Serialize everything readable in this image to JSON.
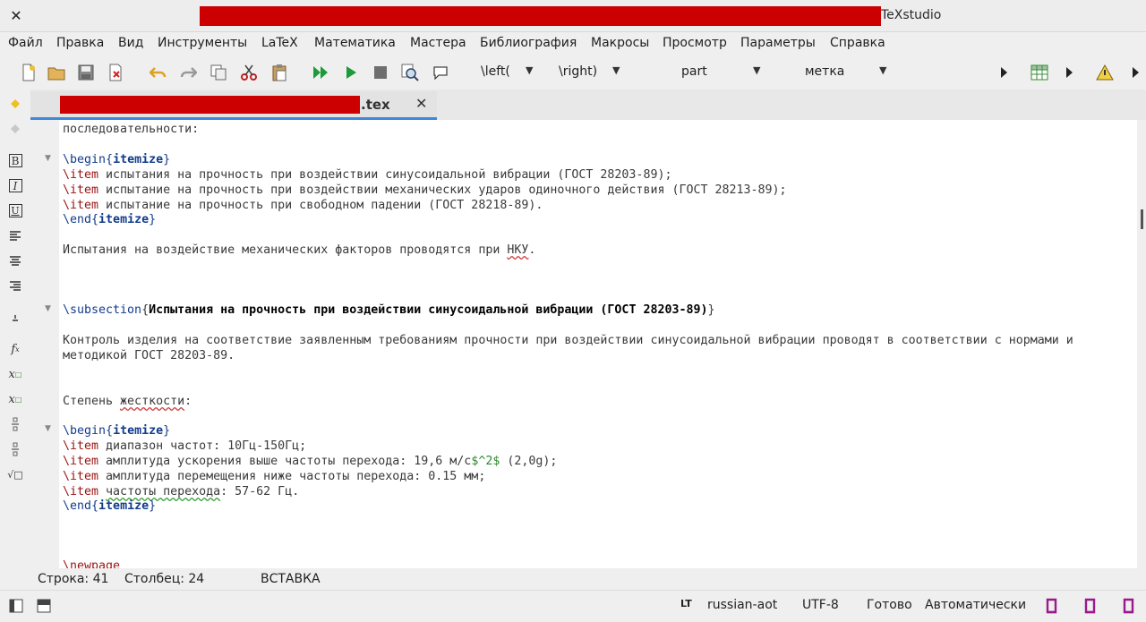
{
  "window": {
    "title": "TeXstudio",
    "close_glyph": "✕"
  },
  "menu": [
    "Файл",
    "Правка",
    "Вид",
    "Инструменты",
    "LaTeX",
    "Математика",
    "Мастера",
    "Библиография",
    "Макросы",
    "Просмотр",
    "Параметры",
    "Справка"
  ],
  "toolbar": {
    "left_combo": "\\left(",
    "right_combo": "\\right)",
    "part_combo": "part",
    "label_combo": "метка"
  },
  "tab": {
    "filename_suffix": ".tex",
    "close_glyph": "✕"
  },
  "editor": {
    "l01": "последовательности:",
    "l03_cmd": "\\begin",
    "l03_env": "itemize",
    "l04_cmd": "\\item",
    "l04_text": " испытания на прочность при воздействии синусоидальной вибрации (ГОСТ 28203-89);",
    "l05_cmd": "\\item",
    "l05_text": " испытание на прочность при воздействии механических ударов одиночного действия (ГОСТ 28213-89);",
    "l06_cmd": "\\item",
    "l06_text": " испытание на прочность при свободном падении (ГОСТ 28218-89).",
    "l07_cmd": "\\end",
    "l07_env": "itemize",
    "l09_a": "Испытания на воздействие механических факторов проводятся при ",
    "l09_spell": "НКУ",
    "l09_b": ".",
    "l13_cmd": "\\subsection",
    "l13_title": "Испытания на прочность при воздействии синусоидальной вибрации (ГОСТ 28203-89)",
    "l15": "Контроль изделия на соответствие заявленным требованиям прочности при воздействии синусоидальной вибрации проводят в соответствии с нормами и",
    "l16": "методикой ГОСТ 28203-89.",
    "l19_a": "Степень ",
    "l19_spell": "жесткости",
    "l19_b": ":",
    "l21_cmd": "\\begin",
    "l21_env": "itemize",
    "l22_cmd": "\\item",
    "l22_text": " диапазон частот: 10Гц-150Гц;",
    "l23_cmd": "\\item",
    "l23_a": " амплитуда ускорения выше частоты перехода: 19,6 м/с",
    "l23_math": "$^2$",
    "l23_b": " (2,0g);",
    "l24_cmd": "\\item",
    "l24_text": " амплитуда перемещения ниже частоты перехода: 0.15 мм;",
    "l25_cmd": "\\item",
    "l25_spell": "частоты перехода",
    "l25_text": ": 57-62 Гц.",
    "l26_cmd": "\\end",
    "l26_env": "itemize",
    "l30_cmd": "\\newpage"
  },
  "position": {
    "row": "Строка: 41",
    "col": "Столбец: 24",
    "mode": "ВСТАВКА"
  },
  "status": {
    "language": "russian-aot",
    "encoding": "UTF-8",
    "state": "Готово",
    "auto": "Автоматически"
  },
  "colors": {
    "accent": "#3f87d9",
    "command": "#9a1414",
    "env": "#123c8c",
    "math": "#2c8a2c"
  }
}
